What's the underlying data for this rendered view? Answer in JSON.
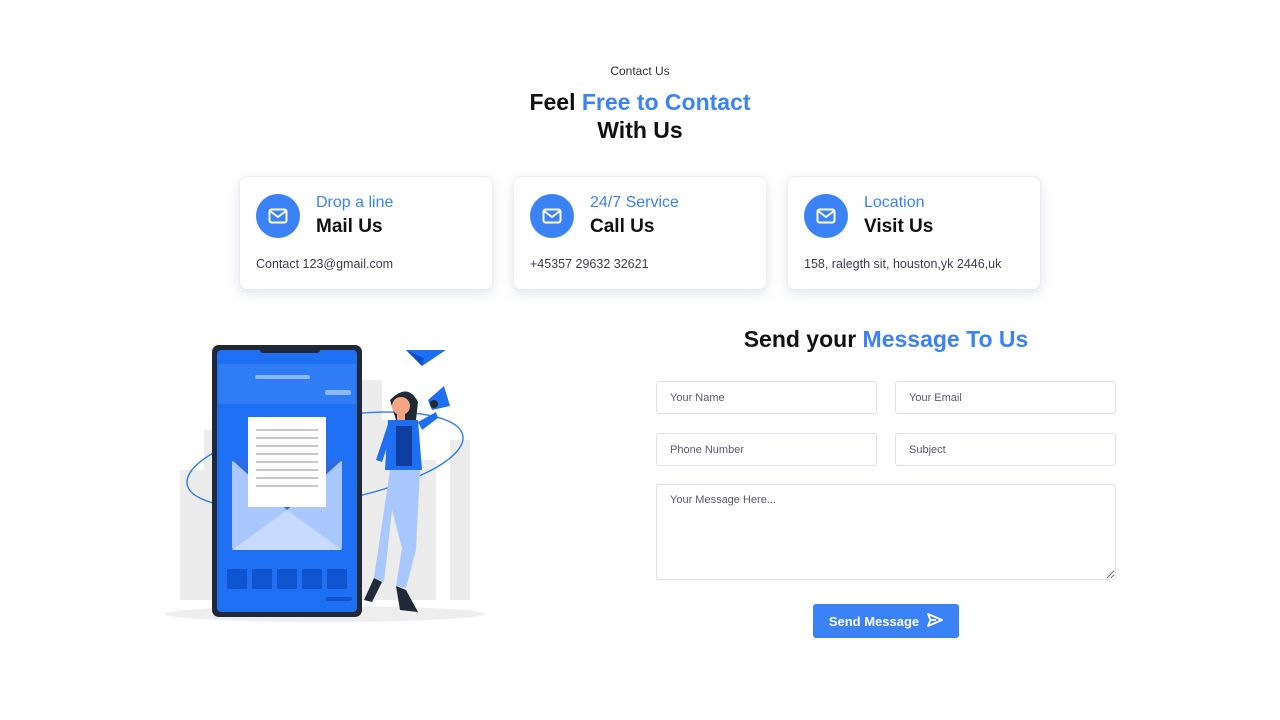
{
  "header": {
    "eyebrow": "Contact Us",
    "title_part1": "Feel",
    "title_accent": "Free to Contact",
    "title_part2": "With Us"
  },
  "cards": [
    {
      "kicker": "Drop a line",
      "title": "Mail Us",
      "detail": "Contact 123@gmail.com",
      "icon": "mail-icon"
    },
    {
      "kicker": "24/7 Service",
      "title": "Call Us",
      "detail": "+45357 29632 32621",
      "icon": "mail-icon"
    },
    {
      "kicker": "Location",
      "title": "Visit Us",
      "detail": "158, ralegth sit, houston,yk 2446,uk",
      "icon": "mail-icon"
    }
  ],
  "form": {
    "title_part1": "Send your",
    "title_accent": "Message To Us",
    "name_placeholder": "Your Name",
    "email_placeholder": "Your Email",
    "phone_placeholder": "Phone Number",
    "subject_placeholder": "Subject",
    "message_placeholder": "Your Message Here...",
    "submit_label": "Send Message",
    "submit_icon": "send-icon"
  },
  "colors": {
    "accent": "#3b82f6",
    "text_dark": "#111111",
    "illustration_blue": "#1f6ff2"
  }
}
